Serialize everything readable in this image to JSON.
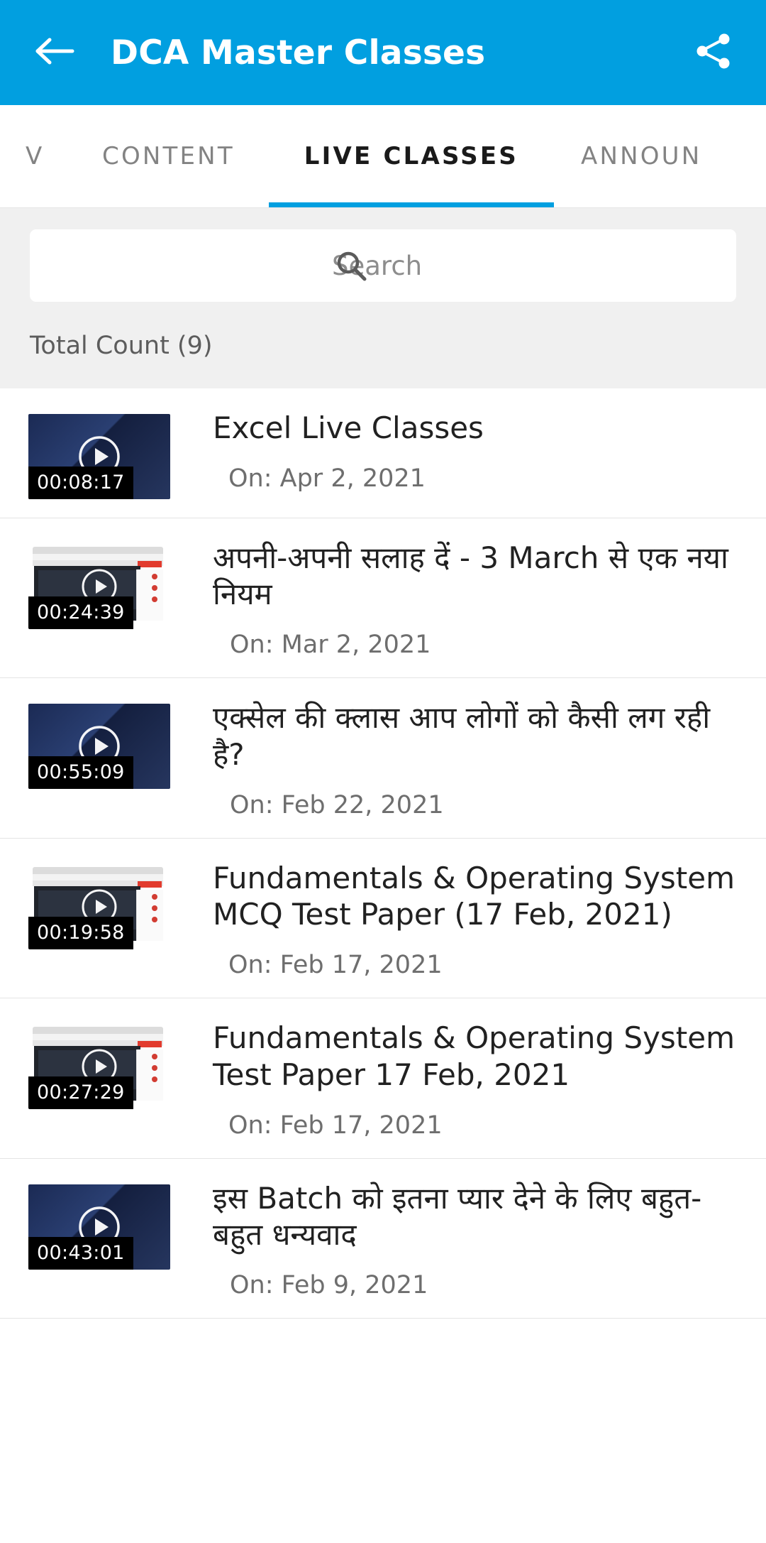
{
  "appbar": {
    "back_icon": "arrow-left-icon",
    "title": "DCA Master Classes",
    "share_icon": "share-icon",
    "background": "#019fe0"
  },
  "tabs": {
    "partial_left_label": "V",
    "items": [
      {
        "label": "CONTENT",
        "active": false
      },
      {
        "label": "LIVE CLASSES",
        "active": true
      },
      {
        "label": "ANNOUN",
        "active": false
      }
    ],
    "indicator_color": "#019fe0"
  },
  "search": {
    "icon": "search-icon",
    "value": "",
    "placeholder": "Search"
  },
  "list_header": {
    "count_text": "Total Count (9)"
  },
  "items": [
    {
      "title": "Excel Live Classes",
      "date_label": "On: Apr 2, 2021",
      "duration": "00:08:17",
      "thumb_type": "dark",
      "play_icon": "play-circle-icon"
    },
    {
      "title": "अपनी-अपनी सलाह दें - 3 March से एक नया नियम",
      "date_label": "On: Mar 2, 2021",
      "duration": "00:24:39",
      "thumb_type": "web",
      "play_icon": "play-circle-icon"
    },
    {
      "title": "एक्सेल की क्लास आप लोगों को कैसी लग रही है?",
      "date_label": "On: Feb 22, 2021",
      "duration": "00:55:09",
      "thumb_type": "dark",
      "play_icon": "play-circle-icon"
    },
    {
      "title": "Fundamentals & Operating System MCQ Test Paper (17 Feb, 2021)",
      "date_label": "On: Feb 17, 2021",
      "duration": "00:19:58",
      "thumb_type": "web",
      "play_icon": "play-circle-icon"
    },
    {
      "title": "Fundamentals & Operating System Test Paper  17 Feb, 2021",
      "date_label": "On: Feb 17, 2021",
      "duration": "00:27:29",
      "thumb_type": "web",
      "play_icon": "play-circle-icon"
    },
    {
      "title": "इस Batch को इतना प्यार देने के लिए बहुत-बहुत धन्यवाद",
      "date_label": "On: Feb 9, 2021",
      "duration": "00:43:01",
      "thumb_type": "dark",
      "play_icon": "play-circle-icon"
    }
  ]
}
